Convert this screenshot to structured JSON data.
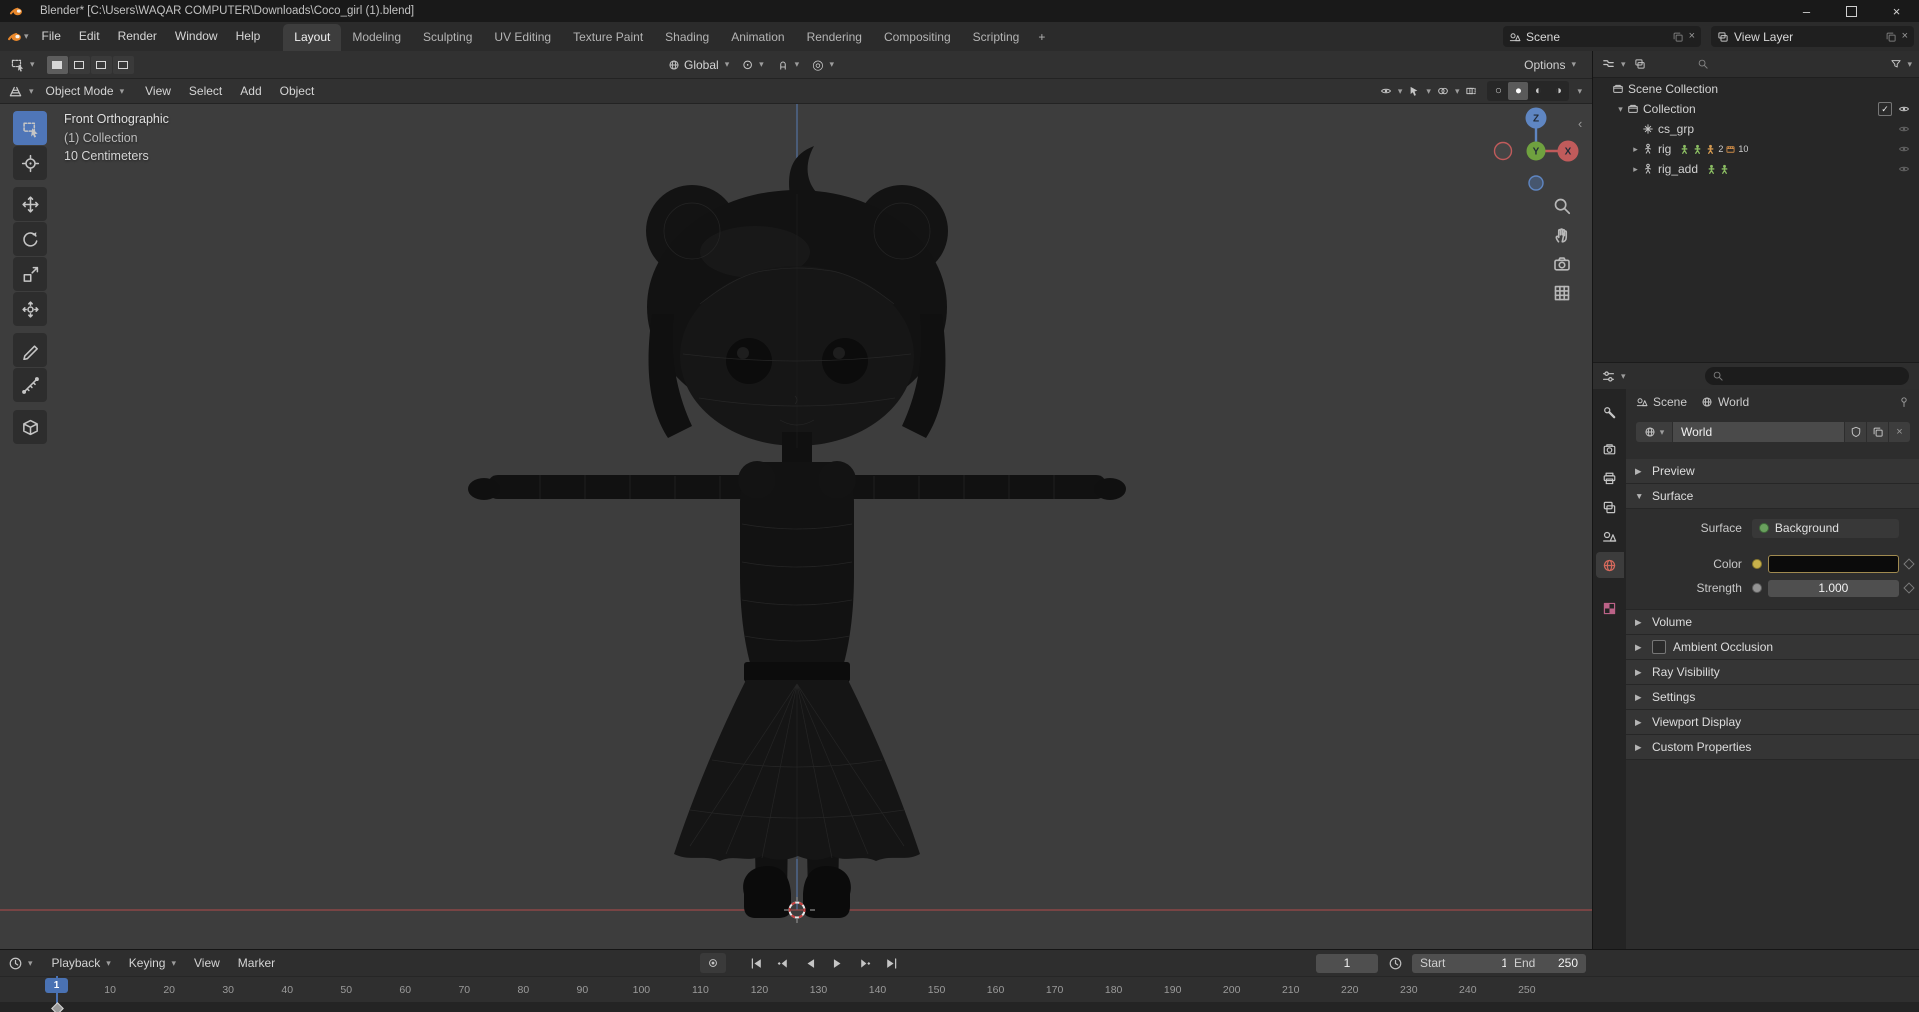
{
  "window": {
    "title": "Blender* [C:\\Users\\WAQAR COMPUTER\\Downloads\\Coco_girl (1).blend]"
  },
  "icons": {
    "dropdown": "▾",
    "tree_open": "▾",
    "tree_closed": "▸",
    "panel_open": "▼",
    "panel_closed": "▶",
    "shading_wireframe": "○",
    "shading_solid": "●",
    "shading_material": "◐",
    "shading_rendered": "◑",
    "proportional_editing": "◎",
    "pivot_point": "⊙",
    "close": "×",
    "window_minimize": "–",
    "region_collapse": "‹",
    "check": "✓"
  },
  "topbar": {
    "menus": [
      "File",
      "Edit",
      "Render",
      "Window",
      "Help"
    ],
    "workspaces": [
      "Layout",
      "Modeling",
      "Sculpting",
      "UV Editing",
      "Texture Paint",
      "Shading",
      "Animation",
      "Rendering",
      "Compositing",
      "Scripting"
    ],
    "active_workspace": "Layout",
    "add_tab": "+",
    "scene_label": "Scene",
    "view_layer_label": "View Layer"
  },
  "tool_settings": {
    "orientation": "Global",
    "options": "Options"
  },
  "viewport_header": {
    "mode": "Object Mode",
    "menus": [
      "View",
      "Select",
      "Add",
      "Object"
    ]
  },
  "viewport": {
    "overlay": [
      "Front Orthographic",
      "(1) Collection",
      "10 Centimeters"
    ],
    "gizmo": {
      "x": "X",
      "y": "Y",
      "z": "Z"
    }
  },
  "outliner": {
    "rows": [
      {
        "label": "Scene Collection",
        "indent": 0,
        "icon": "collection",
        "expand": "none",
        "meta": [],
        "right": []
      },
      {
        "label": "Collection",
        "indent": 1,
        "icon": "collection",
        "expand": "open",
        "meta": [],
        "right": [
          "check",
          "eye"
        ]
      },
      {
        "label": "cs_grp",
        "indent": 2,
        "icon": "group_obj",
        "expand": "none",
        "meta": [],
        "right": [
          "eyedim"
        ]
      },
      {
        "label": "rig",
        "indent": 2,
        "icon": "armature",
        "expand": "closed",
        "meta": [
          {
            "icon": "figure",
            "color": "#8abc62",
            "count": ""
          },
          {
            "icon": "figure",
            "color": "#8abc62",
            "count": ""
          },
          {
            "icon": "figure",
            "color": "#d49a50",
            "count": "2"
          },
          {
            "icon": "clip",
            "color": "#cd8b47",
            "count": "10"
          }
        ],
        "right": [
          "eyedim"
        ]
      },
      {
        "label": "rig_add",
        "indent": 2,
        "icon": "armature",
        "expand": "closed",
        "meta": [
          {
            "icon": "figure",
            "color": "#8abc62",
            "count": ""
          },
          {
            "icon": "figure",
            "color": "#8abc62",
            "count": ""
          }
        ],
        "right": [
          "eyedim"
        ]
      }
    ]
  },
  "properties": {
    "breadcrumb_scene": "Scene",
    "breadcrumb_world": "World",
    "datablock_name": "World",
    "surface_label": "Surface",
    "surface_value": "Background",
    "color_label": "Color",
    "strength_label": "Strength",
    "strength_value": "1.000",
    "panels": [
      {
        "label": "Preview",
        "state": "closed",
        "checkbox": false
      },
      {
        "label": "Surface",
        "state": "open",
        "checkbox": false
      },
      {
        "label": "Volume",
        "state": "closed",
        "checkbox": false
      },
      {
        "label": "Ambient Occlusion",
        "state": "closed",
        "checkbox": true
      },
      {
        "label": "Ray Visibility",
        "state": "closed",
        "checkbox": false
      },
      {
        "label": "Settings",
        "state": "closed",
        "checkbox": false
      },
      {
        "label": "Viewport Display",
        "state": "closed",
        "checkbox": false
      },
      {
        "label": "Custom Properties",
        "state": "closed",
        "checkbox": false
      }
    ]
  },
  "timeline": {
    "menus": [
      {
        "label": "Playback",
        "caret": true
      },
      {
        "label": "Keying",
        "caret": true
      },
      {
        "label": "View",
        "caret": false
      },
      {
        "label": "Marker",
        "caret": false
      }
    ],
    "current_frame": "1",
    "start_label": "Start",
    "start_value": "1",
    "end_label": "End",
    "end_value": "250",
    "ticks": [
      10,
      20,
      30,
      40,
      50,
      60,
      70,
      80,
      90,
      100,
      110,
      120,
      130,
      140,
      150,
      160,
      170,
      180,
      190,
      200,
      210,
      220,
      230,
      240,
      250
    ]
  },
  "colors": {
    "accent_blue": "#4a72b3",
    "axis_x_red": "#a64b4b",
    "axis_z_blue": "#5b83c0",
    "viewport_bg": "#3d3d3d",
    "active_tool_blue": "#4f76b8"
  }
}
